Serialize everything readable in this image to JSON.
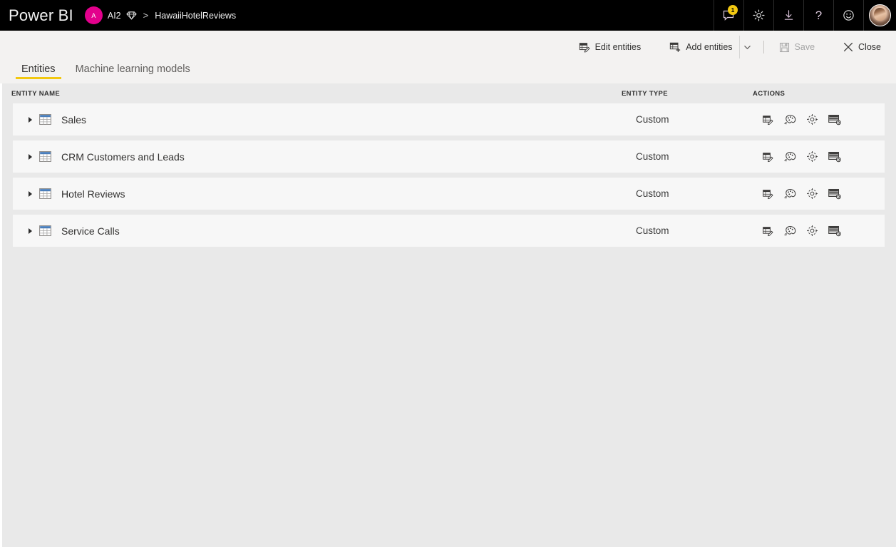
{
  "topbar": {
    "brand": "Power BI",
    "workspace_initial": "A",
    "workspace_name": "AI2",
    "breadcrumb_separator": ">",
    "dataflow_name": "HawaiiHotelReviews",
    "notification_badge": "1",
    "icons": {
      "notifications": "notification-bubble-icon",
      "settings": "gear-icon",
      "download": "download-icon",
      "help": "help-icon",
      "feedback": "smiley-icon",
      "profile": "avatar"
    }
  },
  "commandbar": {
    "edit_entities": "Edit entities",
    "add_entities": "Add entities",
    "save": "Save",
    "save_disabled": true,
    "close": "Close"
  },
  "tabs": [
    {
      "label": "Entities",
      "active": true
    },
    {
      "label": "Machine learning models",
      "active": false
    }
  ],
  "table": {
    "headers": {
      "name": "ENTITY NAME",
      "type": "ENTITY TYPE",
      "actions": "ACTIONS"
    },
    "rows": [
      {
        "name": "Sales",
        "type": "Custom"
      },
      {
        "name": "CRM Customers and Leads",
        "type": "Custom"
      },
      {
        "name": "Hotel Reviews",
        "type": "Custom"
      },
      {
        "name": "Service Calls",
        "type": "Custom"
      }
    ],
    "row_actions": [
      "edit-entity-icon",
      "apply-ml-model-icon",
      "entity-settings-icon",
      "incremental-refresh-icon"
    ]
  },
  "colors": {
    "topbar_bg": "#000000",
    "accent_yellow": "#f2c811",
    "workspace_pink": "#e3008c",
    "commandbar_bg": "#f3f2f1",
    "content_bg": "#e9e9e9",
    "row_bg": "#f7f7f7",
    "table_icon_blue": "#4a7ebb"
  }
}
